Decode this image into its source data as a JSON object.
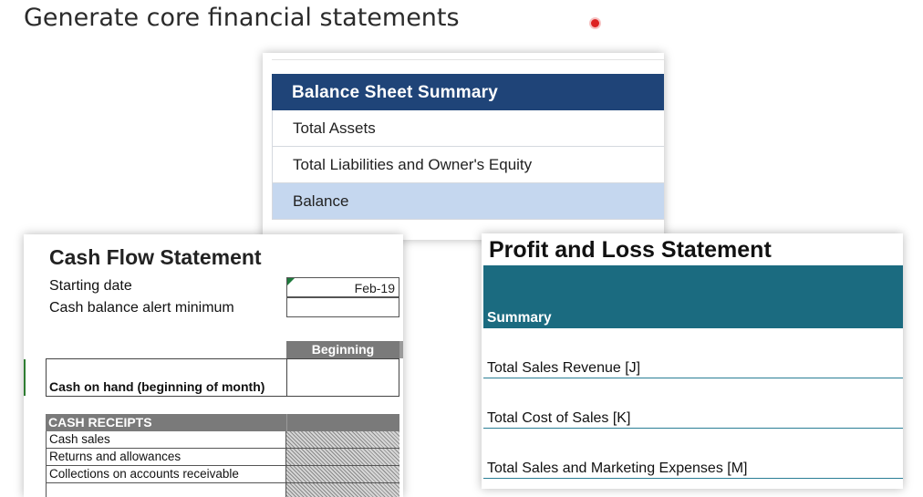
{
  "slide": {
    "title": "Generate core financial statements"
  },
  "balance_sheet": {
    "header": "Balance Sheet Summary",
    "rows": [
      {
        "label": "Total Assets"
      },
      {
        "label": "Total Liabilities and Owner's Equity"
      },
      {
        "label": "Balance"
      }
    ]
  },
  "cash_flow": {
    "title": "Cash Flow Statement",
    "starting_date_label": "Starting date",
    "starting_date_value": "Feb-19",
    "alert_label": "Cash balance alert minimum",
    "alert_value": "",
    "column_header": "Beginning",
    "cash_on_hand_label": "Cash on hand (beginning of month)",
    "receipts_header": "CASH RECEIPTS",
    "receipt_rows": [
      "Cash sales",
      "Returns and allowances",
      "Collections on accounts receivable"
    ]
  },
  "profit_loss": {
    "title": "Profit and Loss Statement",
    "summary_label": "Summary",
    "rows": [
      "Total Sales Revenue  [J]",
      "Total Cost of Sales  [K]",
      "Total Sales and Marketing Expenses  [M]"
    ]
  },
  "colors": {
    "balance_header": "#1f4478",
    "balance_highlight": "#c5d7ef",
    "pl_header": "#1b6b80",
    "cf_header_gray": "#7a7a7a"
  }
}
